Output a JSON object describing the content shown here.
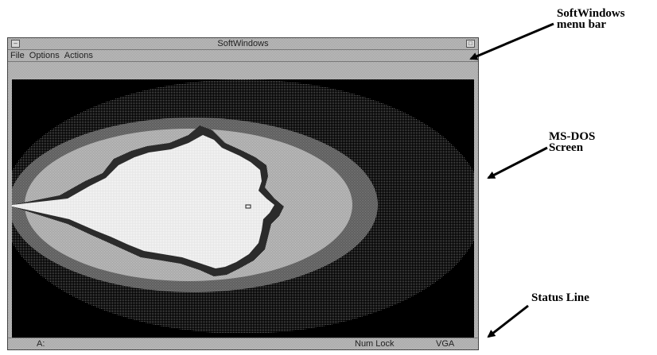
{
  "window": {
    "title": "SoftWindows"
  },
  "menubar": {
    "items": [
      "File",
      "Options",
      "Actions"
    ]
  },
  "statusbar": {
    "drive": "A:",
    "numlock": "Num Lock",
    "video": "VGA"
  },
  "callouts": {
    "menu_bar_line1": "SoftWindows",
    "menu_bar_line2": "menu bar",
    "screen_line1": "MS-DOS",
    "screen_line2": "Screen",
    "status_line": "Status Line"
  }
}
